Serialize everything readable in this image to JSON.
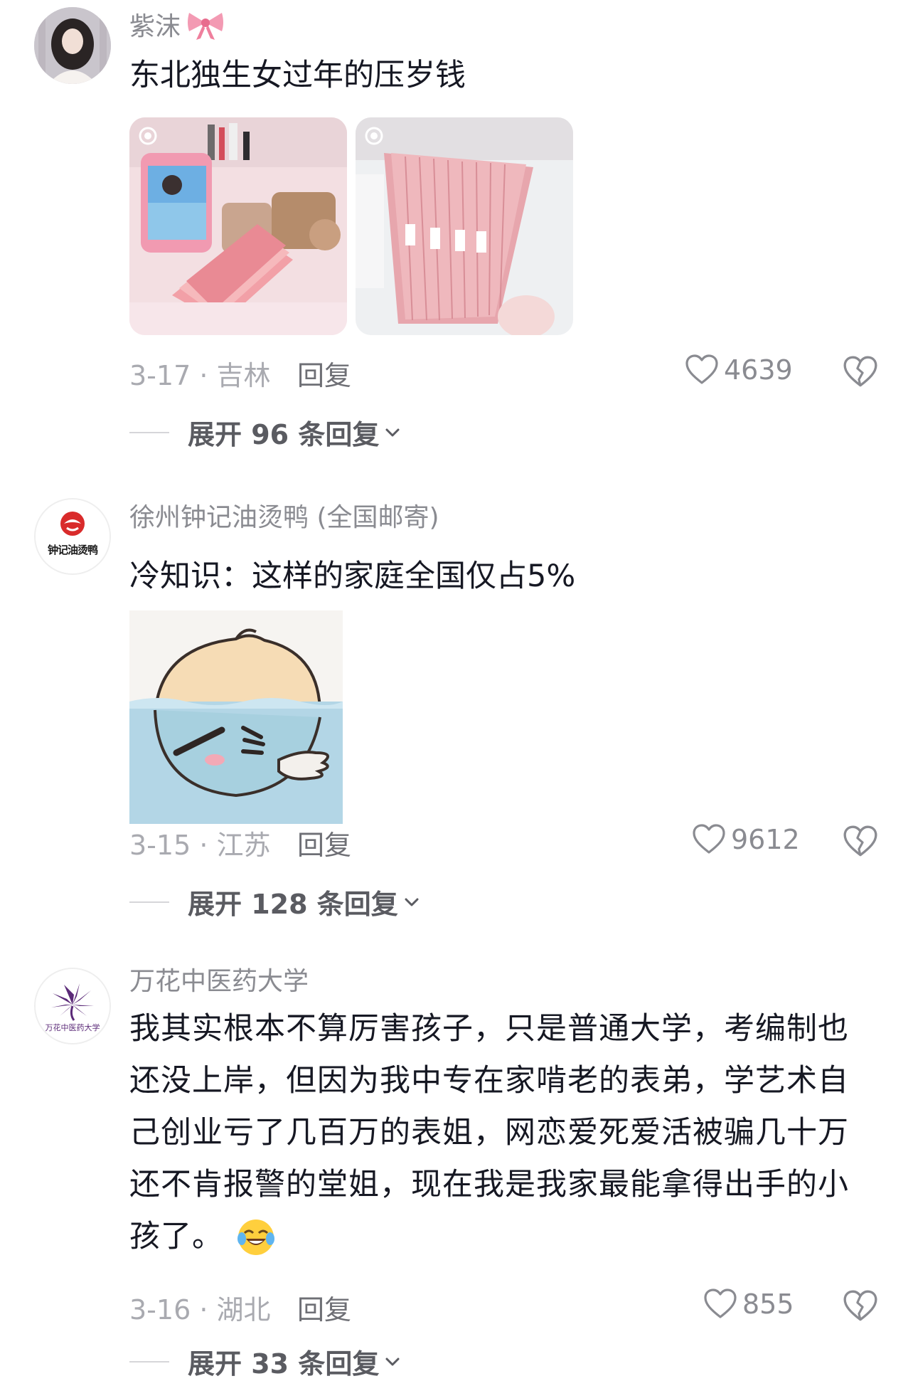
{
  "comments": [
    {
      "username": "紫沫",
      "content": "东北独生女过年的压岁钱",
      "date_location": "3-17 · 吉林",
      "reply_label": "回复",
      "likes": "4639",
      "expand_label": "展开 96 条回复"
    },
    {
      "username": "徐州钟记油烫鸭 (全国邮寄)",
      "avatar_text": "钟记油烫鸭",
      "content": "冷知识：这样的家庭全国仅占5%",
      "date_location": "3-15 · 江苏",
      "reply_label": "回复",
      "likes": "9612",
      "expand_label": "展开 128 条回复"
    },
    {
      "username": "万花中医药大学",
      "avatar_text": "万花中医药大学",
      "content_lines": [
        "我其实根本不算厉害孩子，只是普通大学，考编制也",
        "还没上岸，但因为我中专在家啃老的表弟，学艺术自",
        "己创业亏了几百万的表姐，网恋爱死爱活被骗几十万",
        "还不肯报警的堂姐，现在我是我家最能拿得出手的小",
        "孩了。"
      ],
      "date_location": "3-16 · 湖北",
      "reply_label": "回复",
      "likes": "855",
      "expand_label": "展开 33 条回复"
    }
  ],
  "icons": {
    "like": "heart-outline-icon",
    "dislike": "broken-heart-icon",
    "expand": "chevron-down-icon",
    "username_badge": "pink-bow-icon",
    "emoji": "crying-laughing-emoji-icon"
  },
  "colors": {
    "username": "#8a8b91",
    "meta": "#a9aab0",
    "text": "#161823",
    "bow": "#f08aa6"
  }
}
